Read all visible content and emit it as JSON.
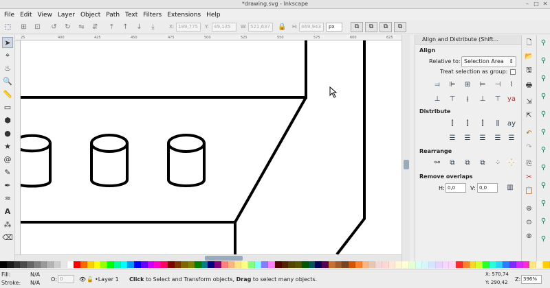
{
  "window": {
    "title": "*drawing.svg - Inkscape",
    "min": "–",
    "max": "□",
    "close": "✕"
  },
  "menu": [
    "File",
    "Edit",
    "View",
    "Layer",
    "Object",
    "Path",
    "Text",
    "Filters",
    "Extensions",
    "Help"
  ],
  "controls": {
    "x_label": "X:",
    "x_value": "189,775",
    "y_label": "Y:",
    "y_value": "49,135",
    "w_label": "W:",
    "w_value": "521,637",
    "h_label": "H:",
    "h_value": "469,943",
    "unit": "px"
  },
  "ruler_top_labels": [
    "25",
    "400",
    "425",
    "450",
    "475",
    "500",
    "525",
    "550",
    "575",
    "600",
    "625"
  ],
  "panel": {
    "title": "Align and Distribute (Shift...",
    "align_heading": "Align",
    "relative_to_label": "Relative to:",
    "relative_to_value": "Selection Area",
    "treat_group_label": "Treat selection as group:",
    "distribute_heading": "Distribute",
    "rearrange_heading": "Rearrange",
    "remove_overlaps_heading": "Remove overlaps",
    "h_label": "H:",
    "h_value": "0,0",
    "v_label": "V:",
    "v_value": "0,0"
  },
  "status": {
    "fill_label": "Fill:",
    "fill_value": "N/A",
    "stroke_label": "Stroke:",
    "stroke_value": "N/A",
    "opacity_label": "O:",
    "opacity_value": "0",
    "layer": "•Layer 1",
    "message_bold1": "Click",
    "message_mid": " to Select and Transform objects, ",
    "message_bold2": "Drag",
    "message_end": " to select many objects.",
    "x_coord": "X: 570,74",
    "y_coord": "Y: 290,42",
    "zoom_label": "Z:",
    "zoom_value": "396%"
  },
  "palette_colors": [
    "#000000",
    "#1a1a1a",
    "#333333",
    "#4d4d4d",
    "#666666",
    "#808080",
    "#999999",
    "#b3b3b3",
    "#cccccc",
    "#e6e6e6",
    "#ffffff",
    "#ff0000",
    "#ff6600",
    "#ffcc00",
    "#ffff00",
    "#99ff00",
    "#00ff00",
    "#00ff99",
    "#00ffff",
    "#0099ff",
    "#0000ff",
    "#6600ff",
    "#cc00ff",
    "#ff00cc",
    "#ff0066",
    "#800000",
    "#803300",
    "#806600",
    "#808000",
    "#008000",
    "#008080",
    "#000080",
    "#800080",
    "#ff8080",
    "#ffb380",
    "#ffe680",
    "#ffff80",
    "#80ff80",
    "#80ffff",
    "#8080ff",
    "#ff80ff",
    "#550000",
    "#552200",
    "#554400",
    "#555500",
    "#005500",
    "#005555",
    "#000055",
    "#550055",
    "#c87137",
    "#a05a2c",
    "#784421",
    "#d45500",
    "#ff7f2a",
    "#ffb380",
    "#e9c6af",
    "#f4d7d7",
    "#ffd5d5",
    "#ffe6d5",
    "#fff6d5",
    "#ffffd5",
    "#e5ffd5",
    "#d5fff6",
    "#d5f6ff",
    "#d5e5ff",
    "#e5d5ff",
    "#f6d5ff",
    "#ffd5f6",
    "#ff2a2a",
    "#ff7f2a",
    "#ffd42a",
    "#d4ff2a",
    "#2aff2a",
    "#2affd4",
    "#2ad4ff",
    "#2a7fff",
    "#7f2aff",
    "#d42aff",
    "#ff2ad4",
    "#ffe680",
    "#fff6d5",
    "#ffcc00"
  ]
}
